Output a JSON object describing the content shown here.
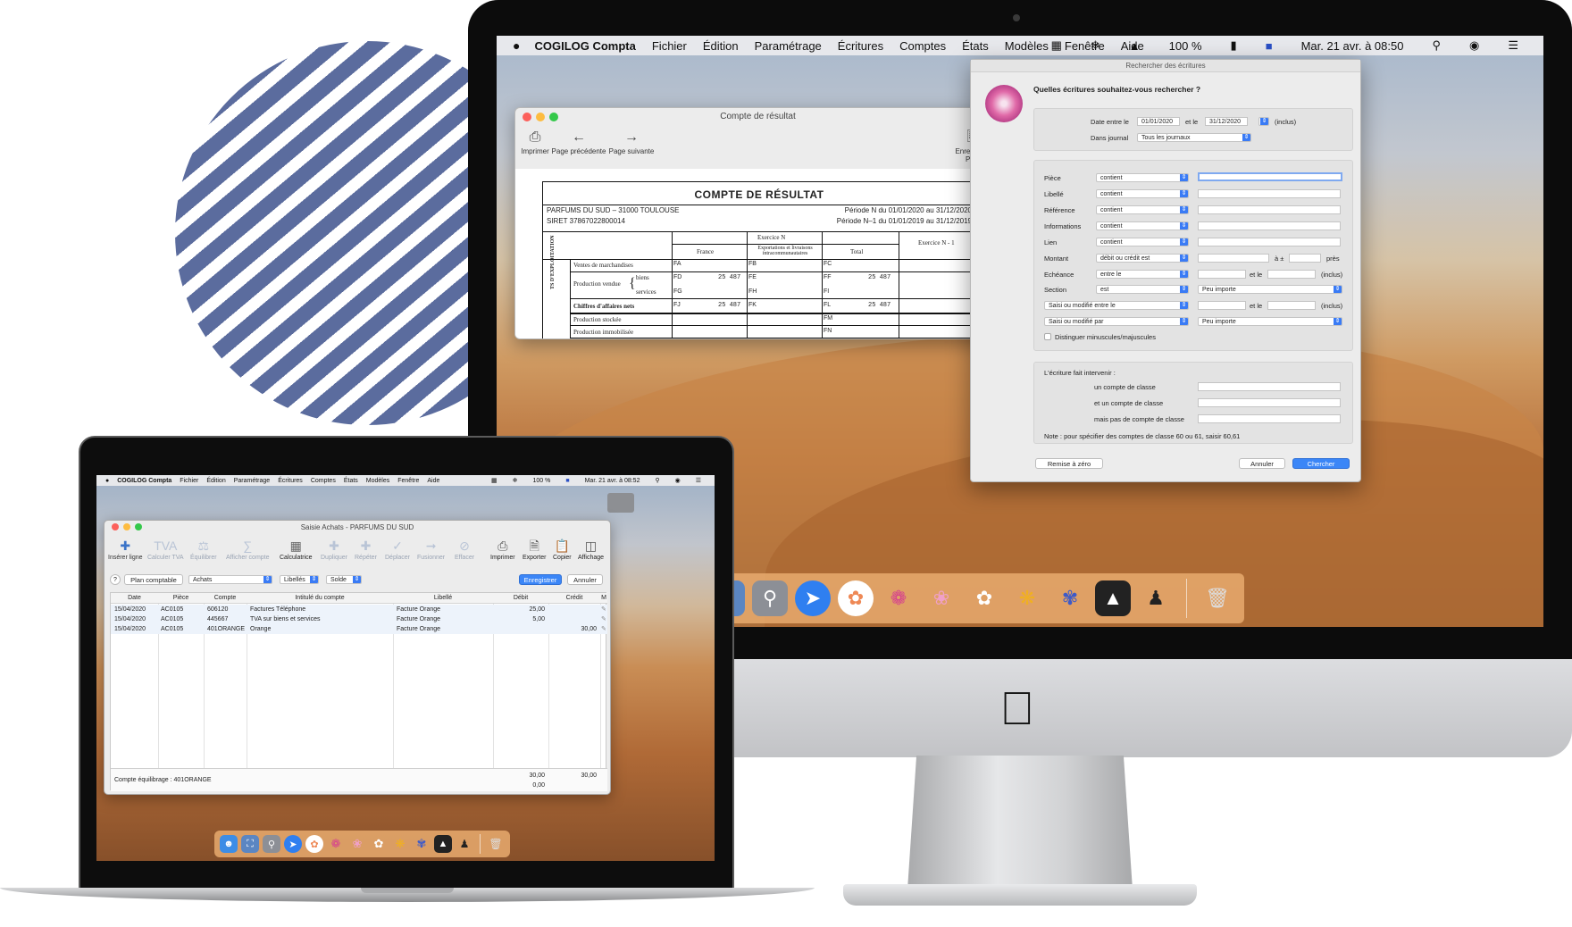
{
  "imac": {
    "menubar": {
      "app_name": "COGILOG Compta",
      "items": [
        "Fichier",
        "Édition",
        "Paramétrage",
        "Écritures",
        "Comptes",
        "États",
        "Modèles",
        "Fenêtre",
        "Aide"
      ],
      "battery": "100 %",
      "datetime": "Mar. 21 avr. à 08:50"
    },
    "compte_resultat_window": {
      "title": "Compte de résultat",
      "toolbar": {
        "print": "Imprimer",
        "prev_page": "Page précédente",
        "next_page": "Page suivante",
        "save_pdf": "Enregistrer PDF"
      },
      "doc": {
        "heading": "COMPTE DE RÉSULTAT",
        "company": "PARFUMS DU SUD – 31000 TOULOUSE",
        "siret": "SIRET 37867022800014",
        "period_n": "Période N du 01/01/2020 au 31/12/2020",
        "period_n1": "Période N–1 du 01/01/2019 au 31/12/2019",
        "exercice_n": "Exercice N",
        "exercice_n1": "Exercice N - 1",
        "col_france": "France",
        "col_export": "Exportations et livraisons intracommunautaires",
        "col_total": "Total",
        "side_label": "TS D'EXPLOITATION",
        "rows": [
          {
            "label": "Ventes de marchandises",
            "c1": "FA",
            "v1": "",
            "c2": "FB",
            "v2": "",
            "c3": "FC",
            "v3": ""
          },
          {
            "label": "Production vendue",
            "sub": "biens",
            "c1": "FD",
            "v1": "25 487",
            "c2": "FE",
            "v2": "",
            "c3": "FF",
            "v3": "25 487"
          },
          {
            "label": "",
            "sub": "services",
            "c1": "FG",
            "v1": "",
            "c2": "FH",
            "v2": "",
            "c3": "FI",
            "v3": ""
          },
          {
            "label": "Chiffres d'affaires nets",
            "c1": "FJ",
            "v1": "25 487",
            "c2": "FK",
            "v2": "",
            "c3": "FL",
            "v3": "25 487"
          },
          {
            "label": "Production stockée",
            "c3": "FM"
          },
          {
            "label": "Production immobilisée",
            "c3": "FN"
          }
        ]
      }
    },
    "search_dialog": {
      "title": "Rechercher des écritures",
      "question": "Quelles écritures souhaitez-vous rechercher ?",
      "date_between": "Date entre le",
      "date_from": "01/01/2020",
      "and_the": "et le",
      "date_to": "31/12/2020",
      "inclusive": "(inclus)",
      "in_journal": "Dans journal",
      "journal_value": "Tous les journaux",
      "criteria": [
        {
          "label": "Pièce",
          "op": "contient"
        },
        {
          "label": "Libellé",
          "op": "contient"
        },
        {
          "label": "Référence",
          "op": "contient"
        },
        {
          "label": "Informations",
          "op": "contient"
        },
        {
          "label": "Lien",
          "op": "contient"
        }
      ],
      "montant_label": "Montant",
      "montant_op": "débit ou crédit est",
      "montant_plusminus": "à ±",
      "montant_pres": "près",
      "echeance_label": "Echéance",
      "echeance_op": "entre le",
      "section_label": "Section",
      "section_op": "est",
      "any_value": "Peu importe",
      "saisi_entre": "Saisi ou modifié entre le",
      "saisi_par": "Saisi ou modifié par",
      "case_sensitive": "Distinguer minuscules/majuscules",
      "involve_title": "L'écriture fait intervenir :",
      "involve_1": "un compte de classe",
      "involve_2": "et un compte de classe",
      "involve_3": "mais pas de compte de classe",
      "note": "Note : pour spécifier des comptes de classe 60 ou 61, saisir 60,61",
      "reset_button": "Remise à zéro",
      "cancel_button": "Annuler",
      "search_button": "Chercher"
    }
  },
  "macbook": {
    "menubar": {
      "app_name": "COGILOG Compta",
      "items": [
        "Fichier",
        "Édition",
        "Paramétrage",
        "Écritures",
        "Comptes",
        "États",
        "Modèles",
        "Fenêtre",
        "Aide"
      ],
      "battery": "100 %",
      "datetime": "Mar. 21 avr. à 08:52"
    },
    "saisie_window": {
      "title": "Saisie Achats - PARFUMS DU SUD",
      "toolbar": [
        "Insérer ligne",
        "Calculer TVA",
        "Équilibrer",
        "Afficher compte",
        "Calculatrice",
        "Dupliquer",
        "Répéter",
        "Déplacer",
        "Fusionner",
        "Effacer",
        "Imprimer",
        "Exporter",
        "Copier",
        "Affichage"
      ],
      "filter": {
        "help": "?",
        "plan_comptable": "Plan comptable",
        "journal": "Achats",
        "libelles": "Libellés",
        "solde": "Solde",
        "save": "Enregistrer",
        "cancel": "Annuler"
      },
      "columns": [
        "Date",
        "Pièce",
        "Compte",
        "Intitulé du compte",
        "Libellé",
        "Débit",
        "Crédit",
        "M"
      ],
      "rows": [
        {
          "date": "15/04/2020",
          "piece": "AC0105",
          "compte": "606120",
          "intitule": "Factures Téléphone",
          "libelle": "Facture Orange",
          "debit": "25,00",
          "credit": ""
        },
        {
          "date": "15/04/2020",
          "piece": "AC0105",
          "compte": "445667",
          "intitule": "TVA sur biens et services",
          "libelle": "Facture Orange",
          "debit": "5,00",
          "credit": ""
        },
        {
          "date": "15/04/2020",
          "piece": "AC0105",
          "compte": "401ORANGE",
          "intitule": "Orange",
          "libelle": "Facture Orange",
          "debit": "",
          "credit": "30,00"
        }
      ],
      "footer": {
        "balance_account": "Compte équilibrage : 401ORANGE",
        "total_debit": "30,00",
        "total_credit": "30,00",
        "diff": "0,00"
      }
    }
  }
}
